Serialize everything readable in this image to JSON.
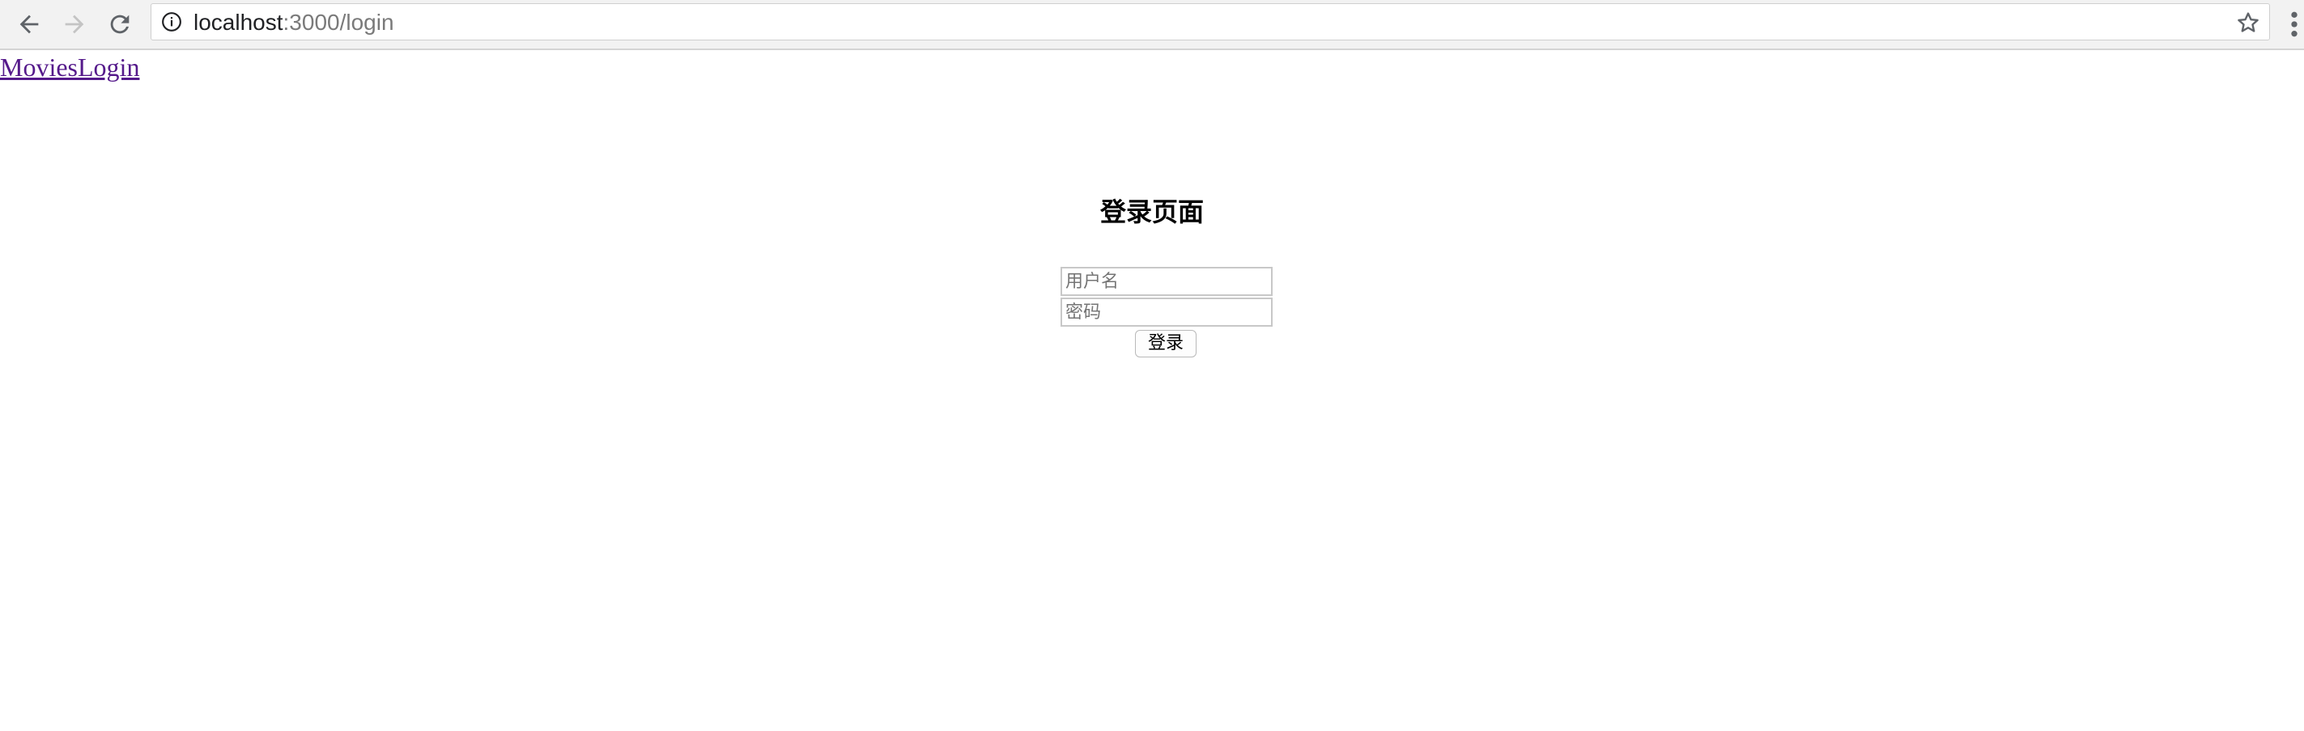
{
  "browser": {
    "url_host": "localhost",
    "url_rest": ":3000/login",
    "icons": {
      "back": "arrow-left-icon",
      "forward": "arrow-right-icon",
      "reload": "reload-icon",
      "info": "info-icon",
      "bookmark": "star-icon",
      "menu": "more-vertical-icon"
    }
  },
  "nav": {
    "movies_link": "Movies",
    "login_link": "Login",
    "link_color": "#551a8b"
  },
  "login": {
    "title": "登录页面",
    "username_placeholder": "用户名",
    "password_placeholder": "密码",
    "submit_label": "登录"
  }
}
